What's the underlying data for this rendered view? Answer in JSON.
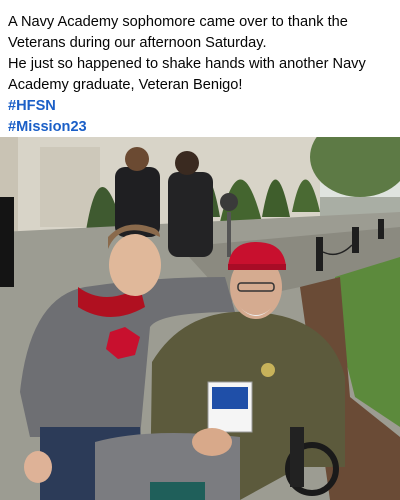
{
  "post": {
    "caption_lines": [
      "A Navy Academy sophomore came over to thank the",
      "Veterans during our afternoon Saturday.",
      "He just so happened to shake hands with another Navy",
      "Academy graduate, Veteran Benigo!"
    ],
    "hashtags": [
      "#HFSN",
      "#Mission23"
    ],
    "hashtag_color": "#1b5fc7",
    "text_color": "#050505"
  },
  "photo": {
    "description_icon": "photo",
    "cap_color": "#c8102e",
    "hoodie_accent": "#c8102e",
    "jacket_color": "#5c5a3c"
  }
}
